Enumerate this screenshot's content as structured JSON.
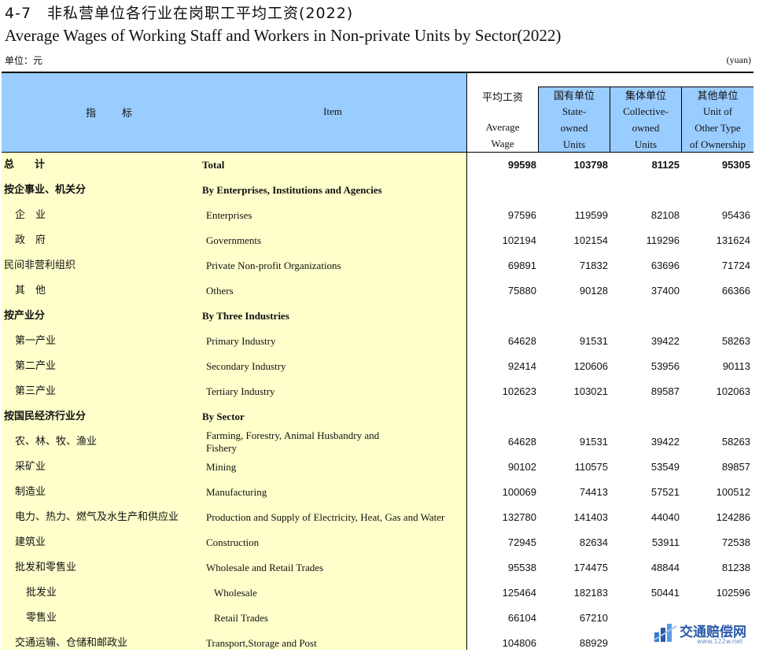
{
  "title_cn": "4-7　非私营单位各行业在岗职工平均工资(2022)",
  "title_en": "Average Wages of Working Staff and Workers in Non-private Units by Sector(2022)",
  "unit_cn": "单位：元",
  "unit_en": "(yuan)",
  "header": {
    "indicator_cn": "指　标",
    "item_en": "Item",
    "col1_cn": "平均工资",
    "col1_en": [
      "Average",
      "Wage"
    ],
    "col2_cn": "国有单位",
    "col2_en": [
      "State-",
      "owned",
      "Units"
    ],
    "col3_cn": "集体单位",
    "col3_en": [
      "Collective-",
      "owned",
      "Units"
    ],
    "col4_cn": "其他单位",
    "col4_en": [
      "Unit of",
      "Other Type",
      "of Ownership"
    ]
  },
  "rows": [
    {
      "cn": "总　　计",
      "en": "Total",
      "v": [
        "99598",
        "103798",
        "81125",
        "95305"
      ]
    },
    {
      "cn": "按企事业、机关分",
      "en": "By Enterprises, Institutions and Agencies",
      "v": [
        "",
        "",
        "",
        ""
      ]
    },
    {
      "cn": "企　业",
      "en": "Enterprises",
      "v": [
        "97596",
        "119599",
        "82108",
        "95436"
      ]
    },
    {
      "cn": "政　府",
      "en": "Governments",
      "v": [
        "102194",
        "102154",
        "119296",
        "131624"
      ]
    },
    {
      "cn": "民间非营利组织",
      "en": "Private Non-profit Organizations",
      "v": [
        "69891",
        "71832",
        "63696",
        "71724"
      ]
    },
    {
      "cn": "其　他",
      "en": "Others",
      "v": [
        "75880",
        "90128",
        "37400",
        "66366"
      ]
    },
    {
      "cn": "按产业分",
      "en": "By Three Industries",
      "v": [
        "",
        "",
        "",
        ""
      ]
    },
    {
      "cn": "第一产业",
      "en": "Primary Industry",
      "v": [
        "64628",
        "91531",
        "39422",
        "58263"
      ]
    },
    {
      "cn": "第二产业",
      "en": "Secondary Industry",
      "v": [
        "92414",
        "120606",
        "53956",
        "90113"
      ]
    },
    {
      "cn": "第三产业",
      "en": "Tertiary Industry",
      "v": [
        "102623",
        "103021",
        "89587",
        "102063"
      ]
    },
    {
      "cn": "按国民经济行业分",
      "en": "By Sector",
      "v": [
        "",
        "",
        "",
        ""
      ]
    },
    {
      "cn": "农、林、牧、渔业",
      "en": "Farming, Forestry, Animal Husbandry and",
      "en2": "Fishery",
      "v": [
        "64628",
        "91531",
        "39422",
        "58263"
      ]
    },
    {
      "cn": "采矿业",
      "en": "Mining",
      "v": [
        "90102",
        "110575",
        "53549",
        "89857"
      ]
    },
    {
      "cn": "制造业",
      "en": "Manufacturing",
      "v": [
        "100069",
        "74413",
        "57521",
        "100512"
      ]
    },
    {
      "cn": "电力、热力、燃气及水生产和供应业",
      "en": "Production and Supply of Electricity, Heat, Gas and Water",
      "v": [
        "132780",
        "141403",
        "44040",
        "124286"
      ]
    },
    {
      "cn": "建筑业",
      "en": "Construction",
      "v": [
        "72945",
        "82634",
        "53911",
        "72538"
      ]
    },
    {
      "cn": "批发和零售业",
      "en": "Wholesale and Retail Trades",
      "v": [
        "95538",
        "174475",
        "48844",
        "81238"
      ]
    },
    {
      "cn": "批发业",
      "en": "Wholesale",
      "v": [
        "125464",
        "182183",
        "50441",
        "102596"
      ]
    },
    {
      "cn": "零售业",
      "en": "Retail Trades",
      "v": [
        "66104",
        "67210",
        "",
        ""
      ]
    },
    {
      "cn": "交通运输、仓储和邮政业",
      "en": "Transport,Storage and Post",
      "v": [
        "104806",
        "88929",
        "",
        ""
      ]
    }
  ],
  "watermark": {
    "text": "交通赔偿网",
    "sub": "www.122w.net"
  }
}
